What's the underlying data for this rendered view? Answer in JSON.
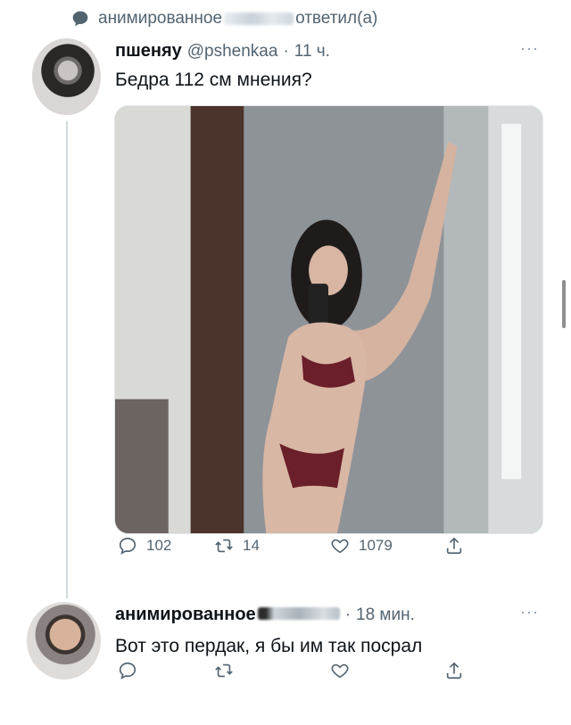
{
  "reply_context": {
    "user": "анимированное",
    "suffix": "ответил(а)",
    "icon": "speech-bubble-icon"
  },
  "tweet": {
    "name": "пшеняу",
    "handle": "@pshenkaa",
    "separator": "·",
    "time": "11 ч.",
    "text": "Бедра 112 см мнения?",
    "more": "···",
    "stats": {
      "replies": "102",
      "retweets": "14",
      "likes": "1079"
    }
  },
  "reply": {
    "name": "анимированное",
    "separator": "·",
    "time": "18 мин.",
    "text": "Вот это пердак, я бы им так посрал",
    "more": "···"
  },
  "colors": {
    "text": "#0f1419",
    "secondary": "#536471",
    "thread_line": "#cfd9de"
  }
}
